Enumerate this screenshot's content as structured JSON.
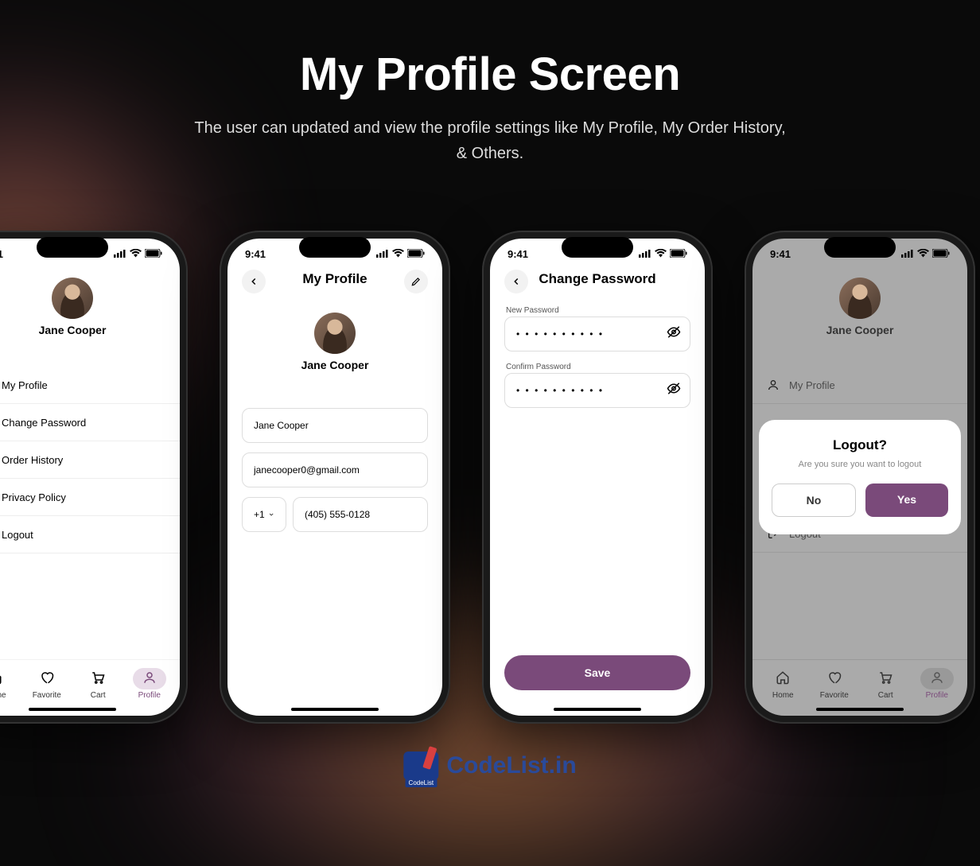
{
  "header": {
    "title": "My Profile Screen",
    "subtitle": "The user can updated and view the profile settings like My Profile, My Order History, & Others."
  },
  "time": "9:41",
  "user": {
    "name": "Jane Cooper"
  },
  "screen1": {
    "menu": [
      "My Profile",
      "Change Password",
      "Order History",
      "Privacy Policy",
      "Logout"
    ]
  },
  "screen2": {
    "title": "My Profile",
    "name": "Jane Cooper",
    "email": "janecooper0@gmail.com",
    "cc": "+1",
    "phone": "(405) 555-0128"
  },
  "screen3": {
    "title": "Change Password",
    "newpw_label": "New Password",
    "confirmpw_label": "Confirm Password",
    "masked": "• • • • • • • • • •",
    "save": "Save"
  },
  "screen4": {
    "menu_top": "My Profile",
    "menu_logout": "Logout",
    "modal": {
      "title": "Logout?",
      "body": "Are you sure you want to logout",
      "no": "No",
      "yes": "Yes"
    }
  },
  "nav": {
    "home": "Home",
    "favorite": "Favorite",
    "cart": "Cart",
    "profile": "Profile"
  },
  "brand": {
    "badge": "CodeList",
    "name": "CodeList.in"
  }
}
